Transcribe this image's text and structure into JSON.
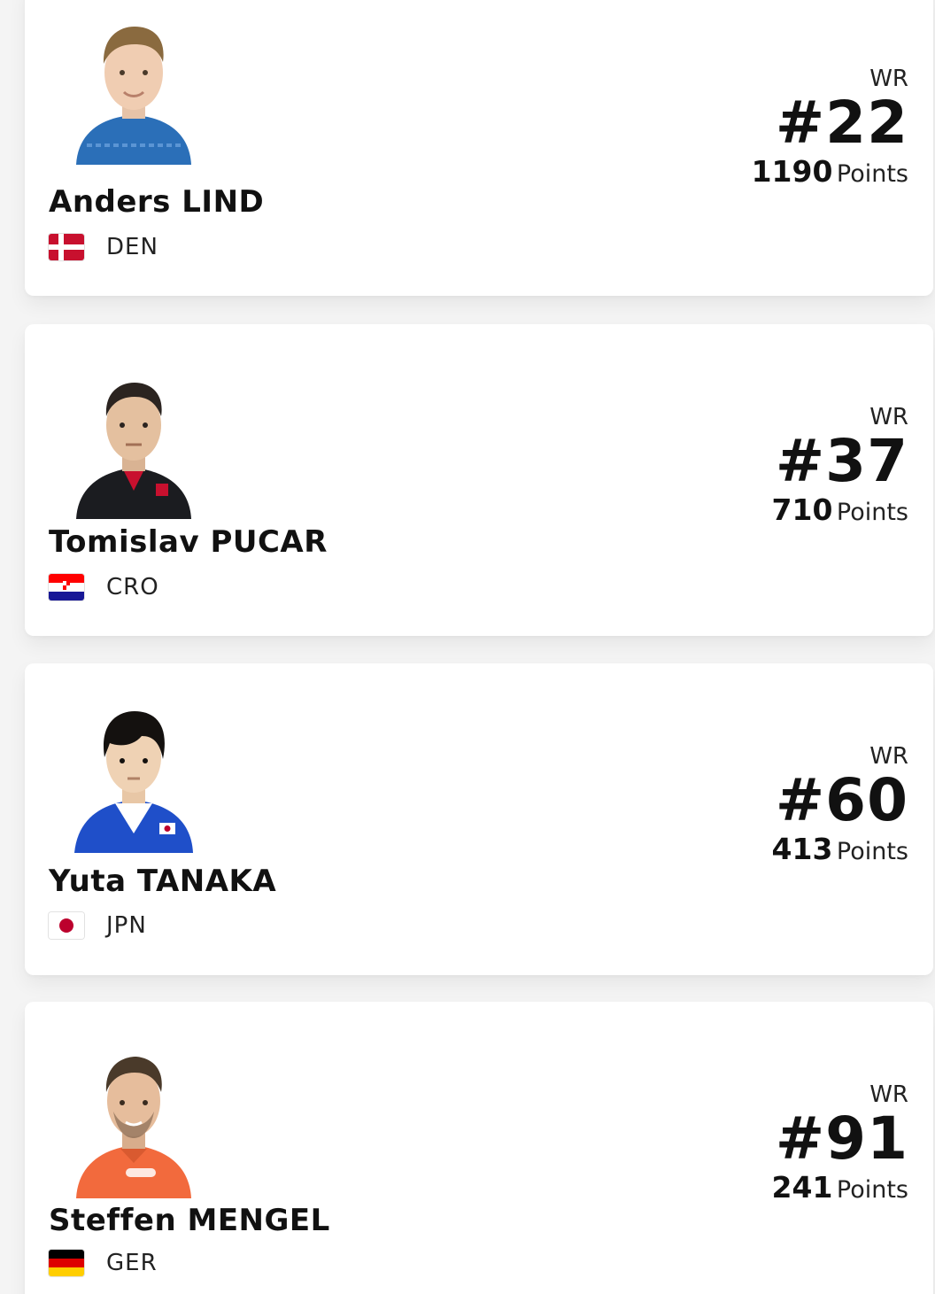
{
  "players": [
    {
      "name": "Anders LIND",
      "country_code": "DEN",
      "flag_icon": "denmark-flag-icon",
      "wr_label": "WR",
      "rank": "#22",
      "points": "1190",
      "points_label": "Points",
      "shirt_color": "#2b6fb8",
      "hair_color": "#8a6a3f"
    },
    {
      "name": "Tomislav PUCAR",
      "country_code": "CRO",
      "flag_icon": "croatia-flag-icon",
      "wr_label": "WR",
      "rank": "#37",
      "points": "710",
      "points_label": "Points",
      "shirt_color": "#1b1c20",
      "hair_color": "#2b2420"
    },
    {
      "name": "Yuta TANAKA",
      "country_code": "JPN",
      "flag_icon": "japan-flag-icon",
      "wr_label": "WR",
      "rank": "#60",
      "points": "413",
      "points_label": "Points",
      "shirt_color": "#1f4fc9",
      "hair_color": "#14110f"
    },
    {
      "name": "Steffen MENGEL",
      "country_code": "GER",
      "flag_icon": "germany-flag-icon",
      "wr_label": "WR",
      "rank": "#91",
      "points": "241",
      "points_label": "Points",
      "shirt_color": "#f26a3d",
      "hair_color": "#4a3a2a"
    }
  ]
}
